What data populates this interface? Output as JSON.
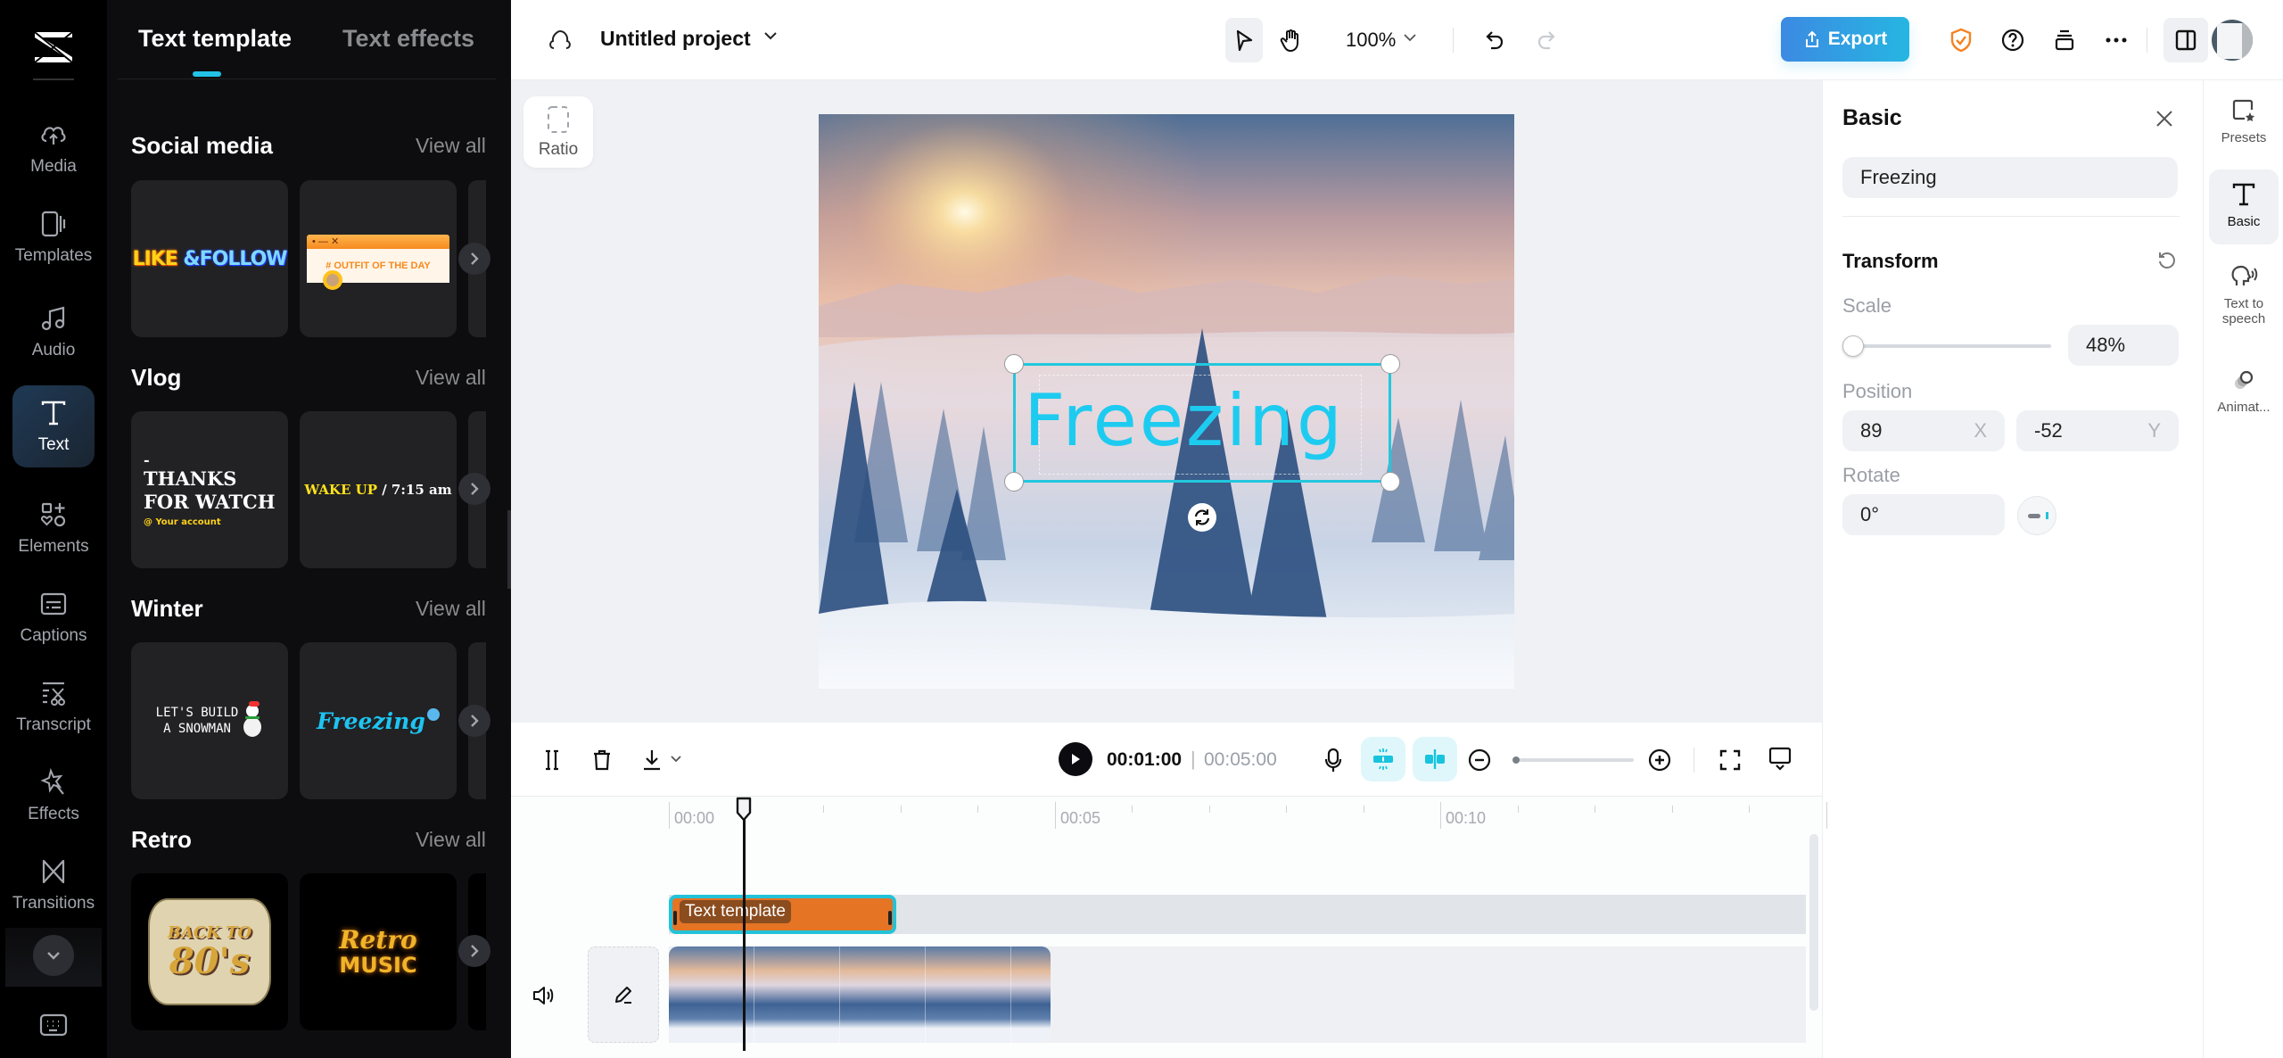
{
  "rail": {
    "items": [
      {
        "label": "Media",
        "icon": "cloud-upload-icon"
      },
      {
        "label": "Templates",
        "icon": "templates-icon"
      },
      {
        "label": "Audio",
        "icon": "music-note-icon"
      },
      {
        "label": "Text",
        "icon": "text-icon",
        "active": true
      },
      {
        "label": "Elements",
        "icon": "elements-icon"
      },
      {
        "label": "Captions",
        "icon": "captions-icon"
      },
      {
        "label": "Transcript",
        "icon": "transcript-icon"
      },
      {
        "label": "Effects",
        "icon": "effects-icon"
      },
      {
        "label": "Transitions",
        "icon": "transitions-icon"
      }
    ]
  },
  "panel": {
    "tabs": [
      {
        "label": "Text template",
        "active": true
      },
      {
        "label": "Text effects",
        "active": false
      }
    ],
    "sections": [
      {
        "title": "Social media",
        "view_all": "View all",
        "cards": [
          "LIKE &FOLLOW",
          "# OUTFIT OF THE DAY"
        ]
      },
      {
        "title": "Vlog",
        "view_all": "View all",
        "cards": [
          "THANKS FOR WATCH",
          "WAKE UP / 7:15 am"
        ],
        "card_sub": "@ Your account",
        "card_dash": "-"
      },
      {
        "title": "Winter",
        "view_all": "View all",
        "cards": [
          "LET'S BUILD A SNOWMAN",
          "Freezing"
        ]
      },
      {
        "title": "Retro",
        "view_all": "View all",
        "cards": [
          "BACK TO 80's",
          "Retro MUSIC"
        ]
      }
    ],
    "card_text": {
      "like": "LIKE",
      "follow": "&FOLLOW",
      "outfit": "# OUTFIT OF THE DAY",
      "thanks1": "THANKS",
      "thanks2": "FOR WATCH",
      "account": "@ Your account",
      "dash": "-",
      "wake": "WAKE UP",
      "time": "/ 7:15 am",
      "snow1": "LET'S BUILD",
      "snow2": "A SNOWMAN",
      "freezing": "Freezing",
      "back": "BACK TO",
      "eighties": "80's",
      "retro": "Retro",
      "music": "MUSIC"
    }
  },
  "header": {
    "project_title": "Untitled project",
    "zoom": "100%",
    "export_label": "Export"
  },
  "stage": {
    "ratio_label": "Ratio",
    "overlay_text": "Freezing",
    "accent": "#22c8dd",
    "text_color": "#1ecbf0"
  },
  "props": {
    "title": "Basic",
    "text_value": "Freezing",
    "transform_label": "Transform",
    "scale_label": "Scale",
    "scale_value": "48%",
    "scale_fraction": 0.05,
    "position_label": "Position",
    "pos_x": "89",
    "pos_x_axis": "X",
    "pos_y": "-52",
    "pos_y_axis": "Y",
    "rotate_label": "Rotate",
    "rotate_value": "0°"
  },
  "right_rail": {
    "items": [
      {
        "label": "Presets",
        "icon": "presets-icon"
      },
      {
        "label": "Basic",
        "icon": "text-icon",
        "active": true
      },
      {
        "label": "Text to speech",
        "icon": "text-to-speech-icon"
      },
      {
        "label": "Animat...",
        "icon": "animation-icon"
      }
    ]
  },
  "timeline": {
    "current_time": "00:01:00",
    "separator": "|",
    "total_time": "00:05:00",
    "ruler_labels": [
      "00:00",
      "00:05",
      "00:10"
    ],
    "text_clip_label": "Text template",
    "text_clip_color": "#e57425"
  }
}
